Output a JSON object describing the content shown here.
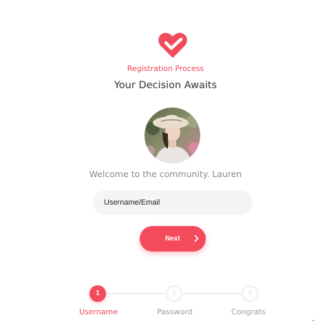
{
  "header": {
    "logo_icon": "heart-check-icon",
    "subtitle": "Registration Process",
    "title": "Your Decision Awaits"
  },
  "profile": {
    "avatar_icon": "user-avatar-photo",
    "welcome_text": "Welcome to the community. Lauren"
  },
  "form": {
    "username_placeholder": "Username/Email",
    "username_value": "",
    "next_label": "Next",
    "next_icon": "chevron-right-icon"
  },
  "steps": [
    {
      "number": "1",
      "label": "Username",
      "state": "active"
    },
    {
      "number": "2",
      "label": "Password",
      "state": "inactive"
    },
    {
      "number": "3",
      "label": "Congrats",
      "state": "inactive"
    }
  ],
  "colors": {
    "accent": "#f34b5c",
    "title_text": "#333333",
    "muted_text": "#8a8a8a",
    "input_bg": "#f5f5f5",
    "step_inactive": "#eeeeee"
  }
}
